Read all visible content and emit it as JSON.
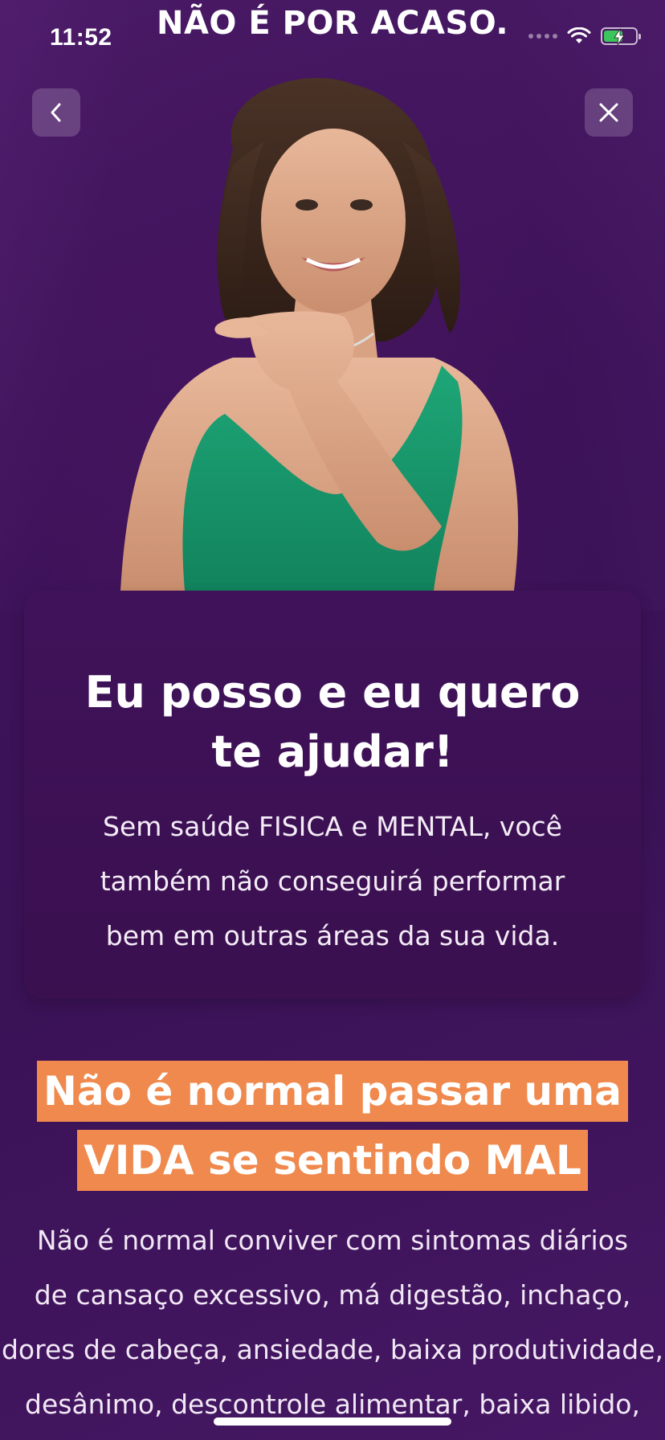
{
  "status_bar": {
    "time": "11:52",
    "battery_level": 0.6
  },
  "banner": {
    "text": "NÃO É POR ACASO."
  },
  "nav": {
    "back_icon": "chevron-left-icon",
    "close_icon": "close-icon"
  },
  "hero": {
    "image": "woman-pointing-photo"
  },
  "card": {
    "title": "Eu posso e eu quero te ajudar!",
    "body_lines": [
      "Sem saúde FISICA e MENTAL, você",
      "também não conseguirá performar",
      "bem em outras áreas da sua vida."
    ]
  },
  "highlight": {
    "line1": "Não é normal passar uma",
    "line2": "VIDA se sentindo MAL",
    "color": "#f0894d"
  },
  "paragraph": {
    "lines": [
      "Não é normal conviver com sintomas diários",
      "de cansaço excessivo, má digestão, inchaço,",
      "dores de cabeça, ansiedade, baixa produtividade,",
      "desânimo, descontrole alimentar, baixa libido,"
    ]
  },
  "colors": {
    "background": "#3f1457",
    "card": "#3a104f",
    "accent": "#f0894d",
    "battery_fill": "#3ac65b"
  }
}
